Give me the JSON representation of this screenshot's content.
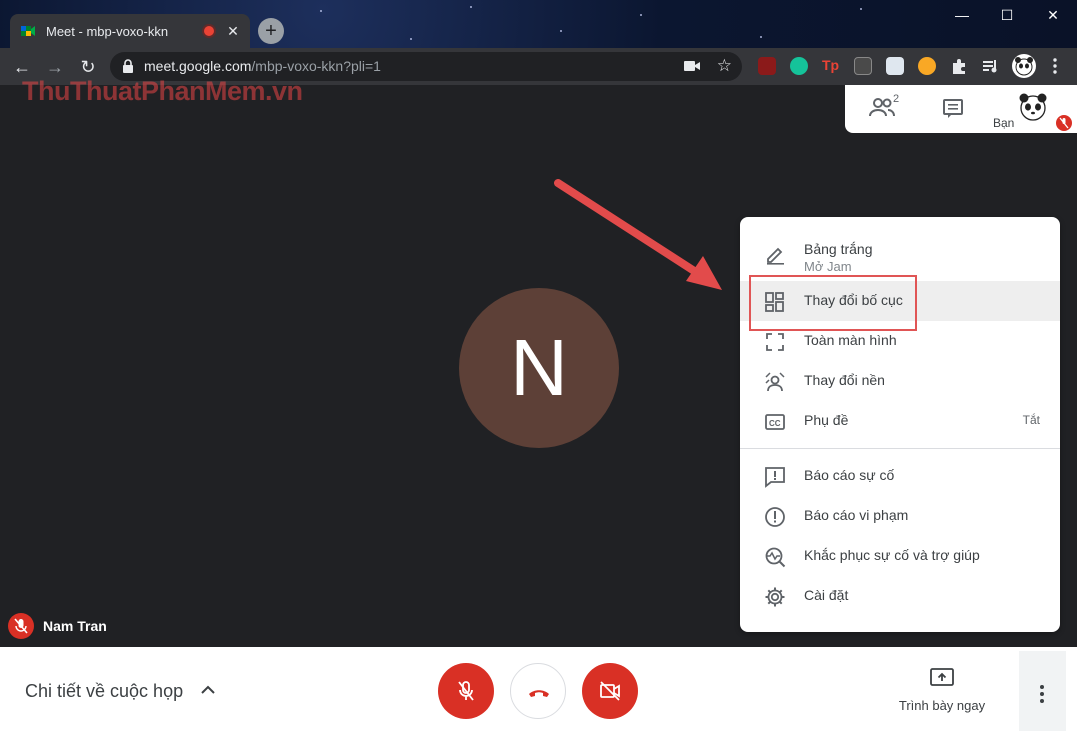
{
  "browser": {
    "tab_title": "Meet - mbp-voxo-kkn",
    "tab_close": "✕",
    "new_tab": "+",
    "url_host": "meet.google.com",
    "url_path": "/mbp-voxo-kkn?pli=1",
    "window_controls": {
      "minimize": "—",
      "maximize": "☐",
      "close": "✕"
    },
    "nav": {
      "back": "←",
      "forward": "→",
      "reload": "↻"
    },
    "extensions": [
      "ublock-icon",
      "grammarly-icon",
      "tp-icon",
      "ext-grid-icon",
      "ext-shield-icon",
      "ext-bolt-icon",
      "puzzle-icon",
      "media-icon",
      "profile-icon",
      "kebab-icon"
    ]
  },
  "watermark": "ThuThuatPhanMem.vn",
  "meet": {
    "participants_count": "2",
    "you_label": "Bạn",
    "big_avatar_letter": "N",
    "participant_name": "Nam Tran",
    "menu": {
      "items": [
        {
          "label": "Bảng trắng",
          "sub": "Mở Jam",
          "icon": "pen-icon"
        },
        {
          "label": "Thay đổi bố cục",
          "icon": "layout-icon"
        },
        {
          "label": "Toàn màn hình",
          "icon": "fullscreen-icon"
        },
        {
          "label": "Thay đổi nền",
          "icon": "background-icon"
        },
        {
          "label": "Phụ đề",
          "aux": "Tắt",
          "icon": "captions-icon"
        },
        {
          "label": "Báo cáo sự cố",
          "icon": "feedback-icon"
        },
        {
          "label": "Báo cáo vi phạm",
          "icon": "alert-icon"
        },
        {
          "label": "Khắc phục sự cố và trợ giúp",
          "icon": "troubleshoot-icon"
        },
        {
          "label": "Cài đặt",
          "icon": "settings-icon"
        }
      ]
    },
    "bottom": {
      "details_label": "Chi tiết về cuộc họp",
      "present_label": "Trình bày ngay"
    }
  },
  "colors": {
    "red": "#d93025",
    "avatar_bg": "#5d4037",
    "highlight_box": "#e05555"
  }
}
